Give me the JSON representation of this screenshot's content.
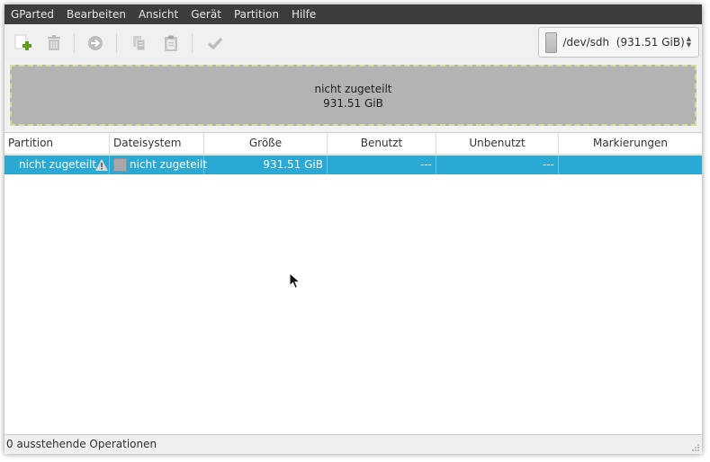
{
  "menubar": {
    "items": [
      "GParted",
      "Bearbeiten",
      "Ansicht",
      "Gerät",
      "Partition",
      "Hilfe"
    ]
  },
  "toolbar": {
    "buttons": [
      {
        "icon": "new-partition-icon",
        "enabled": true
      },
      {
        "icon": "delete-icon",
        "enabled": false
      },
      {
        "icon": "resize-move-icon",
        "enabled": false
      },
      {
        "icon": "copy-icon",
        "enabled": false
      },
      {
        "icon": "paste-icon",
        "enabled": false
      },
      {
        "icon": "apply-icon",
        "enabled": false
      }
    ]
  },
  "device_selector": {
    "label": "/dev/sdh  (931.51 GiB)"
  },
  "disk_map": {
    "label": "nicht zugeteilt",
    "size": "931.51 GiB"
  },
  "table": {
    "columns": [
      "Partition",
      "Dateisystem",
      "Größe",
      "Benutzt",
      "Unbenutzt",
      "Markierungen"
    ],
    "rows": [
      {
        "partition": "nicht zugeteilt",
        "filesystem": "nicht zugeteilt",
        "size": "931.51 GiB",
        "used": "---",
        "unused": "---",
        "flags": ""
      }
    ]
  },
  "statusbar": {
    "text": "0 ausstehende Operationen"
  },
  "colors": {
    "menubar_bg": "#3c3c3c",
    "selection": "#2aa9d4",
    "unallocated": "#b3b3b3",
    "add_green": "#5a9e1a"
  }
}
